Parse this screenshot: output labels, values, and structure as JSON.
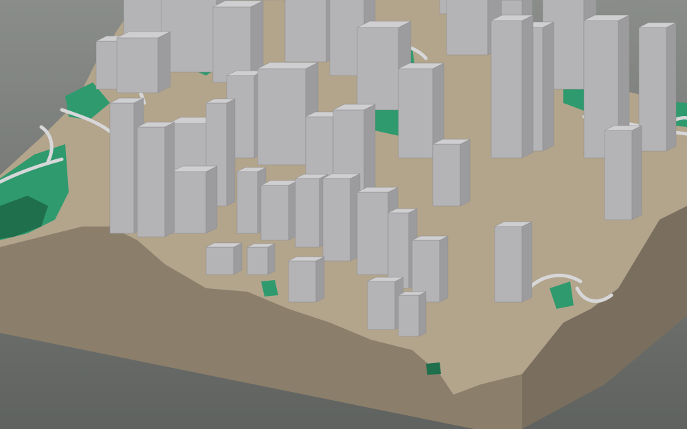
{
  "scene": {
    "subject": "3d-city-terrain-model",
    "colors": {
      "background_top": "#8a8d8a",
      "background_bottom": "#5f625f",
      "terrain_side": "#8b7e6b",
      "terrain_side_dark": "#7a6f5e",
      "soil": "#b3a58c",
      "vegetation": "#2f9a6e",
      "vegetation_dark": "#1f6f4c",
      "building_top": "#cfcfd1",
      "building_left": "#b4b4b7",
      "building_right": "#9c9c9f",
      "road": "#d7d7d9"
    }
  }
}
